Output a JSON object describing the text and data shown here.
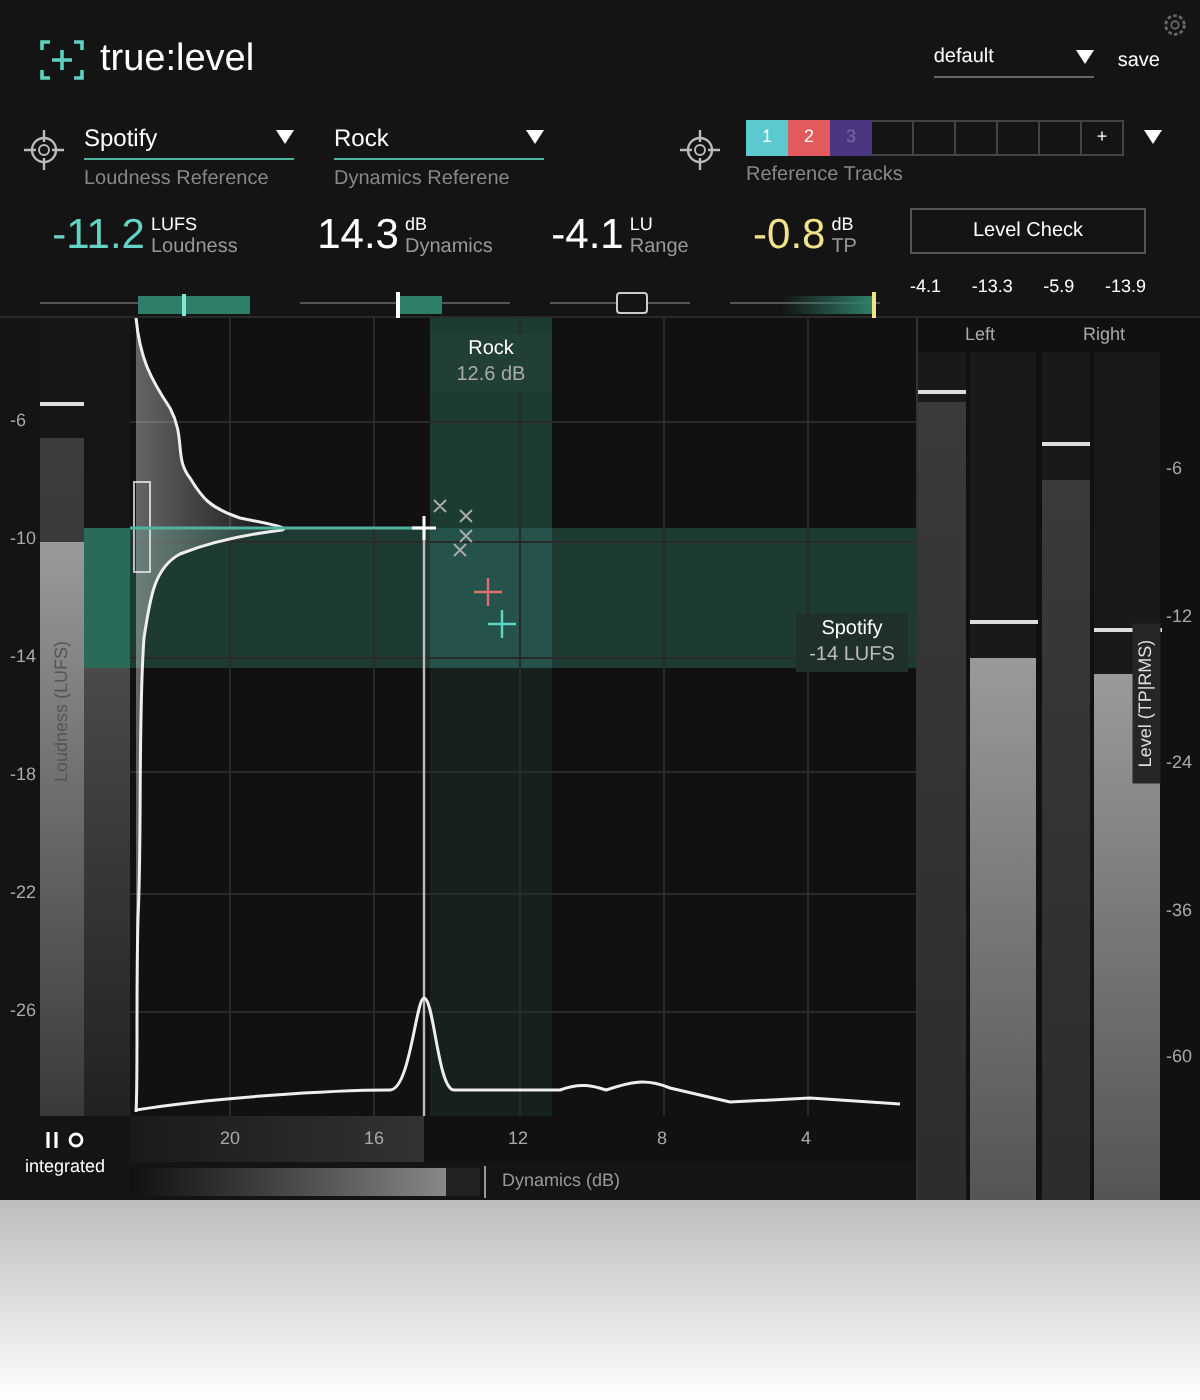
{
  "app": {
    "name": "true:level"
  },
  "preset": {
    "value": "default",
    "save": "save"
  },
  "loudness_reference": {
    "value": "Spotify",
    "label": "Loudness Reference"
  },
  "dynamics_reference": {
    "value": "Rock",
    "label": "Dynamics Referene"
  },
  "reference_tracks": {
    "label": "Reference Tracks",
    "add": "+",
    "slots": [
      {
        "kind": "track",
        "label": "1",
        "color": "#5cc9d1",
        "selected": true
      },
      {
        "kind": "track",
        "label": "2",
        "color": "#e25a5c",
        "selected": true
      },
      {
        "kind": "track",
        "label": "3",
        "color": "#4b3680",
        "selected": false
      },
      {
        "kind": "empty"
      },
      {
        "kind": "empty"
      },
      {
        "kind": "empty"
      },
      {
        "kind": "empty"
      },
      {
        "kind": "empty"
      }
    ]
  },
  "readouts": [
    {
      "kind": "loudness",
      "value": "-11.2",
      "unit": "LUFS",
      "label": "Loudness",
      "color": "#62d3c4",
      "level": 0.68
    },
    {
      "kind": "dynamics",
      "value": "14.3",
      "unit": "dB",
      "label": "Dynamics",
      "color": "#ffffff",
      "level": 0.46
    },
    {
      "kind": "range",
      "value": "-4.1",
      "unit": "LU",
      "label": "Range",
      "color": "#ffffff",
      "level": 0.58
    },
    {
      "kind": "peak",
      "value": "-0.8",
      "unit": "dB",
      "label": "TP",
      "color": "#f1e38a",
      "level": 0.94
    }
  ],
  "level_check": {
    "button": "Level Check",
    "values": [
      "-4.1",
      "-13.3",
      "-5.9",
      "-13.9"
    ]
  },
  "chart": {
    "y_label": "Loudness (LUFS)",
    "y_ticks": [
      "-6",
      "-10",
      "-14",
      "-18",
      "-22",
      "-26"
    ],
    "x_ticks": [
      "20",
      "16",
      "12",
      "8",
      "4"
    ],
    "x_label": "Dynamics (dB)",
    "dynamics_target": {
      "name": "Rock",
      "value": "12.6 dB"
    },
    "loudness_target": {
      "name": "Spotify",
      "value": "-14 LUFS"
    }
  },
  "loudness_meter": {
    "short_term": {
      "level": 0.85,
      "hold": {
        "level": 0.89
      }
    },
    "integrated": {
      "level": 0.72
    }
  },
  "dynamics_meter": {
    "level": 0.9
  },
  "transport": {
    "label": "integrated"
  },
  "level_meter": {
    "label": "Level (TP|RMS)",
    "ticks": [
      "-6",
      "-12",
      "-24",
      "-36",
      "-60"
    ],
    "channels": [
      {
        "name": "Left",
        "true_peak": {
          "level": 0.94,
          "hold": {
            "level": 0.95
          }
        },
        "rms": {
          "level": 0.64,
          "hold": {
            "level": 0.68
          }
        }
      },
      {
        "name": "Right",
        "true_peak": {
          "level": 0.85,
          "hold": {
            "level": 0.89
          }
        },
        "rms": {
          "level": 0.62,
          "hold": {
            "level": 0.67
          }
        }
      }
    ]
  }
}
